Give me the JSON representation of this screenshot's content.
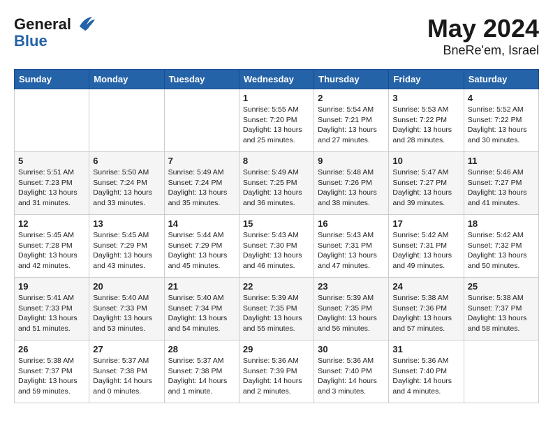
{
  "header": {
    "logo_line1": "General",
    "logo_line2": "Blue",
    "month": "May 2024",
    "location": "BneRe'em, Israel"
  },
  "weekdays": [
    "Sunday",
    "Monday",
    "Tuesday",
    "Wednesday",
    "Thursday",
    "Friday",
    "Saturday"
  ],
  "weeks": [
    [
      {
        "day": "",
        "info": ""
      },
      {
        "day": "",
        "info": ""
      },
      {
        "day": "",
        "info": ""
      },
      {
        "day": "1",
        "info": "Sunrise: 5:55 AM\nSunset: 7:20 PM\nDaylight: 13 hours\nand 25 minutes."
      },
      {
        "day": "2",
        "info": "Sunrise: 5:54 AM\nSunset: 7:21 PM\nDaylight: 13 hours\nand 27 minutes."
      },
      {
        "day": "3",
        "info": "Sunrise: 5:53 AM\nSunset: 7:22 PM\nDaylight: 13 hours\nand 28 minutes."
      },
      {
        "day": "4",
        "info": "Sunrise: 5:52 AM\nSunset: 7:22 PM\nDaylight: 13 hours\nand 30 minutes."
      }
    ],
    [
      {
        "day": "5",
        "info": "Sunrise: 5:51 AM\nSunset: 7:23 PM\nDaylight: 13 hours\nand 31 minutes."
      },
      {
        "day": "6",
        "info": "Sunrise: 5:50 AM\nSunset: 7:24 PM\nDaylight: 13 hours\nand 33 minutes."
      },
      {
        "day": "7",
        "info": "Sunrise: 5:49 AM\nSunset: 7:24 PM\nDaylight: 13 hours\nand 35 minutes."
      },
      {
        "day": "8",
        "info": "Sunrise: 5:49 AM\nSunset: 7:25 PM\nDaylight: 13 hours\nand 36 minutes."
      },
      {
        "day": "9",
        "info": "Sunrise: 5:48 AM\nSunset: 7:26 PM\nDaylight: 13 hours\nand 38 minutes."
      },
      {
        "day": "10",
        "info": "Sunrise: 5:47 AM\nSunset: 7:27 PM\nDaylight: 13 hours\nand 39 minutes."
      },
      {
        "day": "11",
        "info": "Sunrise: 5:46 AM\nSunset: 7:27 PM\nDaylight: 13 hours\nand 41 minutes."
      }
    ],
    [
      {
        "day": "12",
        "info": "Sunrise: 5:45 AM\nSunset: 7:28 PM\nDaylight: 13 hours\nand 42 minutes."
      },
      {
        "day": "13",
        "info": "Sunrise: 5:45 AM\nSunset: 7:29 PM\nDaylight: 13 hours\nand 43 minutes."
      },
      {
        "day": "14",
        "info": "Sunrise: 5:44 AM\nSunset: 7:29 PM\nDaylight: 13 hours\nand 45 minutes."
      },
      {
        "day": "15",
        "info": "Sunrise: 5:43 AM\nSunset: 7:30 PM\nDaylight: 13 hours\nand 46 minutes."
      },
      {
        "day": "16",
        "info": "Sunrise: 5:43 AM\nSunset: 7:31 PM\nDaylight: 13 hours\nand 47 minutes."
      },
      {
        "day": "17",
        "info": "Sunrise: 5:42 AM\nSunset: 7:31 PM\nDaylight: 13 hours\nand 49 minutes."
      },
      {
        "day": "18",
        "info": "Sunrise: 5:42 AM\nSunset: 7:32 PM\nDaylight: 13 hours\nand 50 minutes."
      }
    ],
    [
      {
        "day": "19",
        "info": "Sunrise: 5:41 AM\nSunset: 7:33 PM\nDaylight: 13 hours\nand 51 minutes."
      },
      {
        "day": "20",
        "info": "Sunrise: 5:40 AM\nSunset: 7:33 PM\nDaylight: 13 hours\nand 53 minutes."
      },
      {
        "day": "21",
        "info": "Sunrise: 5:40 AM\nSunset: 7:34 PM\nDaylight: 13 hours\nand 54 minutes."
      },
      {
        "day": "22",
        "info": "Sunrise: 5:39 AM\nSunset: 7:35 PM\nDaylight: 13 hours\nand 55 minutes."
      },
      {
        "day": "23",
        "info": "Sunrise: 5:39 AM\nSunset: 7:35 PM\nDaylight: 13 hours\nand 56 minutes."
      },
      {
        "day": "24",
        "info": "Sunrise: 5:38 AM\nSunset: 7:36 PM\nDaylight: 13 hours\nand 57 minutes."
      },
      {
        "day": "25",
        "info": "Sunrise: 5:38 AM\nSunset: 7:37 PM\nDaylight: 13 hours\nand 58 minutes."
      }
    ],
    [
      {
        "day": "26",
        "info": "Sunrise: 5:38 AM\nSunset: 7:37 PM\nDaylight: 13 hours\nand 59 minutes."
      },
      {
        "day": "27",
        "info": "Sunrise: 5:37 AM\nSunset: 7:38 PM\nDaylight: 14 hours\nand 0 minutes."
      },
      {
        "day": "28",
        "info": "Sunrise: 5:37 AM\nSunset: 7:38 PM\nDaylight: 14 hours\nand 1 minute."
      },
      {
        "day": "29",
        "info": "Sunrise: 5:36 AM\nSunset: 7:39 PM\nDaylight: 14 hours\nand 2 minutes."
      },
      {
        "day": "30",
        "info": "Sunrise: 5:36 AM\nSunset: 7:40 PM\nDaylight: 14 hours\nand 3 minutes."
      },
      {
        "day": "31",
        "info": "Sunrise: 5:36 AM\nSunset: 7:40 PM\nDaylight: 14 hours\nand 4 minutes."
      },
      {
        "day": "",
        "info": ""
      }
    ]
  ]
}
